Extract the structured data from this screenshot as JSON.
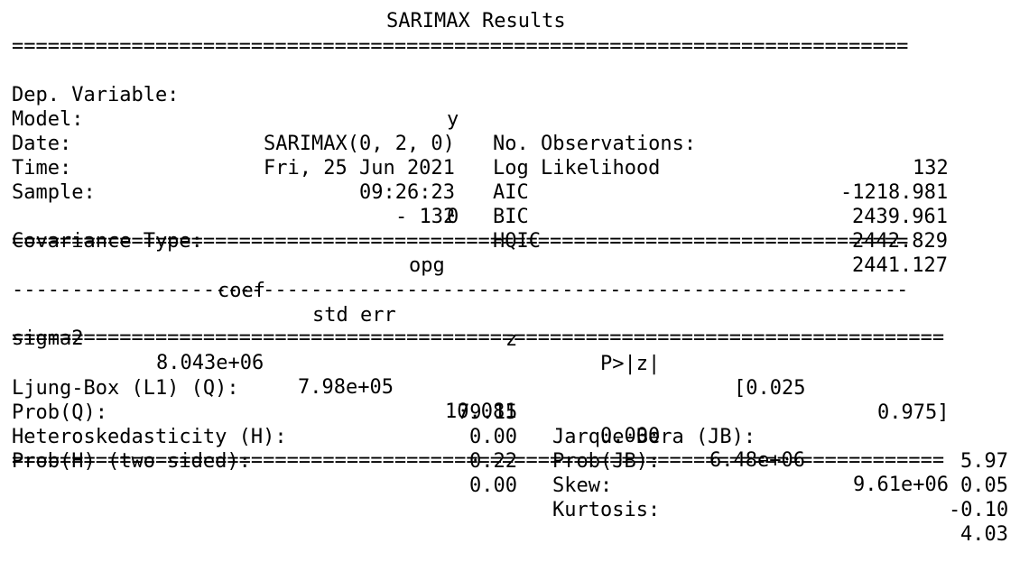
{
  "title": "SARIMAX Results",
  "sep_eq_top": "===========================================================================",
  "sep_eq_full": "==============================================================================",
  "sep_dash": "---------------------------------------------------------------------------",
  "header": {
    "dep_label": "Dep. Variable:",
    "dep_value": "y",
    "nobs_label": "No. Observations:",
    "nobs_value": "132",
    "model_label": "Model:",
    "model_value": "SARIMAX(0, 2, 0)",
    "loglik_label": "Log Likelihood",
    "loglik_value": "-1218.981",
    "date_label": "Date:",
    "date_value": "Fri, 25 Jun 2021",
    "aic_label": "AIC",
    "aic_value": "2439.961",
    "time_label": "Time:",
    "time_value": "09:26:23",
    "bic_label": "BIC",
    "bic_value": "2442.829",
    "sample_label": "Sample:",
    "sample_value": "0",
    "hqic_label": "HQIC",
    "hqic_value": "2441.127",
    "sample_end": "- 132",
    "cov_label": "Covariance Type:",
    "cov_value": "opg"
  },
  "coef_table": {
    "headers": [
      "coef",
      "std err",
      "z",
      "P>|z|",
      "[0.025",
      "0.975]"
    ],
    "rows": [
      {
        "name": "sigma2",
        "values": [
          "8.043e+06",
          "7.98e+05",
          "10.081",
          "0.000",
          "6.48e+06",
          "9.61e+06"
        ]
      }
    ]
  },
  "diagnostics": {
    "ljung_label": "Ljung-Box (L1) (Q):",
    "ljung_value": "79.15",
    "jb_label": "Jarque-Bera (JB):",
    "jb_value": "5.97",
    "probq_label": "Prob(Q):",
    "probq_value": "0.00",
    "probjb_label": "Prob(JB):",
    "probjb_value": "0.05",
    "het_label": "Heteroskedasticity (H):",
    "het_value": "0.22",
    "skew_label": "Skew:",
    "skew_value": "-0.10",
    "probh_label": "Prob(H) (two-sided):",
    "probh_value": "0.00",
    "kurt_label": "Kurtosis:",
    "kurt_value": "4.03"
  }
}
